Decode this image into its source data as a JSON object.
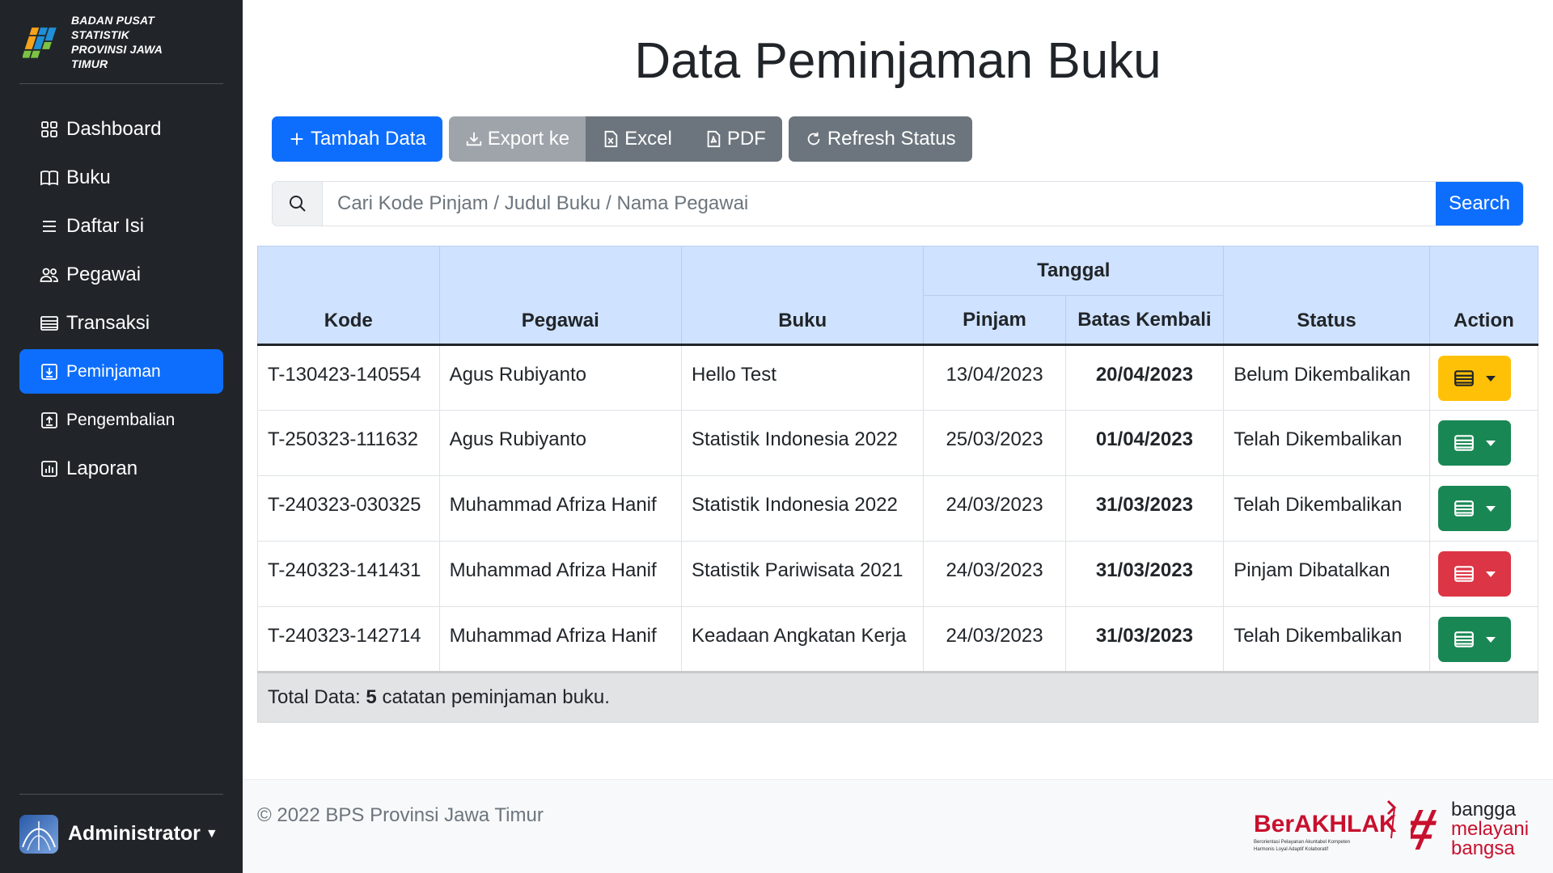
{
  "sidebar": {
    "brand": {
      "line1": "BADAN PUSAT STATISTIK",
      "line2": "PROVINSI JAWA TIMUR"
    },
    "items": [
      {
        "label": "Dashboard",
        "icon": "grid-icon"
      },
      {
        "label": "Buku",
        "icon": "book-icon"
      },
      {
        "label": "Daftar Isi",
        "icon": "list-icon"
      },
      {
        "label": "Pegawai",
        "icon": "people-icon"
      },
      {
        "label": "Transaksi",
        "icon": "card-list-icon"
      },
      {
        "label": "Peminjaman",
        "icon": "box-arrow-in-down-icon",
        "active": true
      },
      {
        "label": "Pengembalian",
        "icon": "box-arrow-up-icon"
      },
      {
        "label": "Laporan",
        "icon": "bar-chart-icon"
      }
    ],
    "user": {
      "name": "Administrator"
    }
  },
  "main": {
    "title": "Data Peminjaman Buku",
    "toolbar": {
      "add_label": "Tambah Data",
      "export_label": "Export ke",
      "excel_label": "Excel",
      "pdf_label": "PDF",
      "refresh_label": "Refresh Status"
    },
    "search": {
      "placeholder": "Cari Kode Pinjam / Judul Buku / Nama Pegawai",
      "button_label": "Search"
    },
    "table": {
      "headers": {
        "kode": "Kode",
        "pegawai": "Pegawai",
        "buku": "Buku",
        "tanggal": "Tanggal",
        "pinjam": "Pinjam",
        "batas": "Batas Kembali",
        "status": "Status",
        "action": "Action"
      },
      "rows": [
        {
          "kode": "T-130423-140554",
          "pegawai": "Agus Rubiyanto",
          "buku": "Hello Test",
          "pinjam": "13/04/2023",
          "batas": "20/04/2023",
          "status": "Belum Dikembalikan",
          "action_color": "#ffc107"
        },
        {
          "kode": "T-250323-111632",
          "pegawai": "Agus Rubiyanto",
          "buku": "Statistik Indonesia 2022",
          "pinjam": "25/03/2023",
          "batas": "01/04/2023",
          "status": "Telah Dikembalikan",
          "action_color": "#198754"
        },
        {
          "kode": "T-240323-030325",
          "pegawai": "Muhammad Afriza Hanif",
          "buku": "Statistik Indonesia 2022",
          "pinjam": "24/03/2023",
          "batas": "31/03/2023",
          "status": "Telah Dikembalikan",
          "action_color": "#198754"
        },
        {
          "kode": "T-240323-141431",
          "pegawai": "Muhammad Afriza Hanif",
          "buku": "Statistik Pariwisata 2021",
          "pinjam": "24/03/2023",
          "batas": "31/03/2023",
          "status": "Pinjam Dibatalkan",
          "action_color": "#dc3545"
        },
        {
          "kode": "T-240323-142714",
          "pegawai": "Muhammad Afriza Hanif",
          "buku": "Keadaan Angkatan Kerja",
          "pinjam": "24/03/2023",
          "batas": "31/03/2023",
          "status": "Telah Dikembalikan",
          "action_color": "#198754"
        }
      ],
      "total": {
        "prefix": "Total Data:",
        "count": "5",
        "suffix": "catatan peminjaman buku."
      }
    }
  },
  "footer": {
    "copyright": "© 2022 BPS Provinsi Jawa Timur",
    "logo_berakhlak": {
      "name": "BerAKHLAK",
      "tagline1": "Berorientasi Pelayanan Akuntabel Kompeten",
      "tagline2": "Harmonis Loyal Adaptif Kolaboratif"
    },
    "logo_bangga": {
      "line1": "bangga",
      "line2": "melayani",
      "line3": "bangsa"
    }
  },
  "colors": {
    "primary": "#0d6efd",
    "sidebar_bg": "#212529",
    "header_bg": "#cfe2ff",
    "warning": "#ffc107",
    "success": "#198754",
    "danger": "#dc3545",
    "brand_red": "#c8102e"
  }
}
